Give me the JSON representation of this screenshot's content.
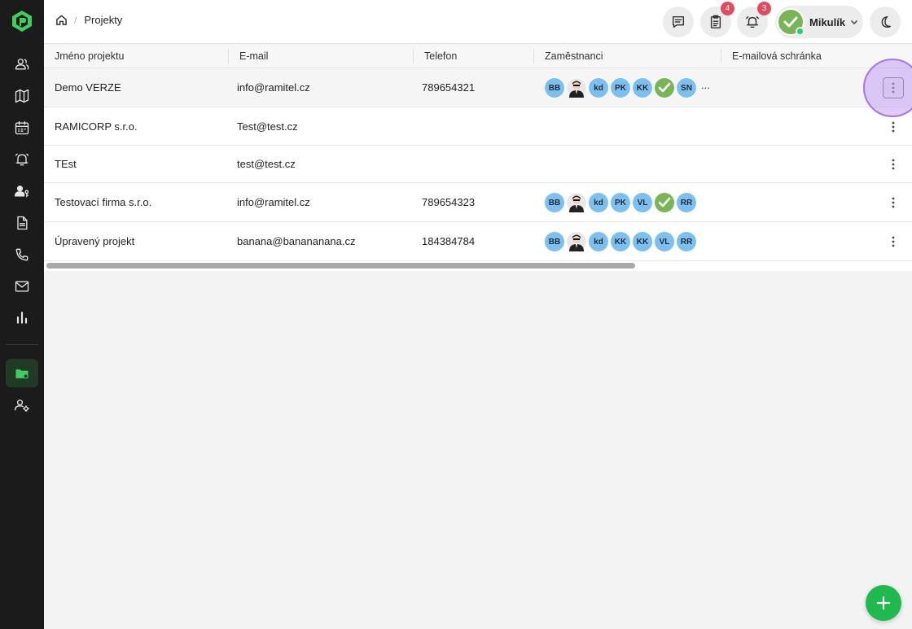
{
  "breadcrumb": {
    "current": "Projekty"
  },
  "header": {
    "tasks_badge": "4",
    "notifications_badge": "3",
    "user_name": "Mikulík"
  },
  "table": {
    "columns": [
      "Jméno projektu",
      "E-mail",
      "Telefon",
      "Zaměstnanci",
      "E-mailová schránka"
    ],
    "rows": [
      {
        "name": "Demo VERZE",
        "email": "info@ramitel.cz",
        "phone": "789654321",
        "employees": [
          "BB",
          "photo",
          "kd",
          "PK",
          "KK",
          "ok",
          "SN"
        ],
        "more": "..."
      },
      {
        "name": "RAMICORP s.r.o.",
        "email": "Test@test.cz",
        "phone": "",
        "employees": [],
        "more": ""
      },
      {
        "name": "TEst",
        "email": "test@test.cz",
        "phone": "",
        "employees": [],
        "more": ""
      },
      {
        "name": "Testovací firma s.r.o.",
        "email": "info@ramitel.cz",
        "phone": "789654323",
        "employees": [
          "BB",
          "photo",
          "kd",
          "PK",
          "VL",
          "ok",
          "RR"
        ],
        "more": ""
      },
      {
        "name": "Úpravený projekt",
        "email": "banana@banananana.cz",
        "phone": "184384784",
        "employees": [
          "BB",
          "photo",
          "kd",
          "KK",
          "KK",
          "VL",
          "RR"
        ],
        "more": ""
      }
    ]
  },
  "colors": {
    "accent": "#1fba4f",
    "sidebar": "#1b1b1b",
    "highlight_ring": "#a874e8",
    "badge": "#e24a5b",
    "avatar": "#7cc0f0"
  },
  "icons": {
    "sidebar": [
      "users-icon",
      "map-icon",
      "calendar-icon",
      "alarm-icon",
      "user-key-icon",
      "document-icon",
      "phone-icon",
      "mail-icon",
      "bar-chart-icon",
      "folder-icon",
      "user-settings-icon"
    ],
    "header": [
      "home-icon",
      "chat-icon",
      "clipboard-icon",
      "bell-icon",
      "chevron-down-icon",
      "moon-icon"
    ],
    "fab": "plus-icon"
  }
}
